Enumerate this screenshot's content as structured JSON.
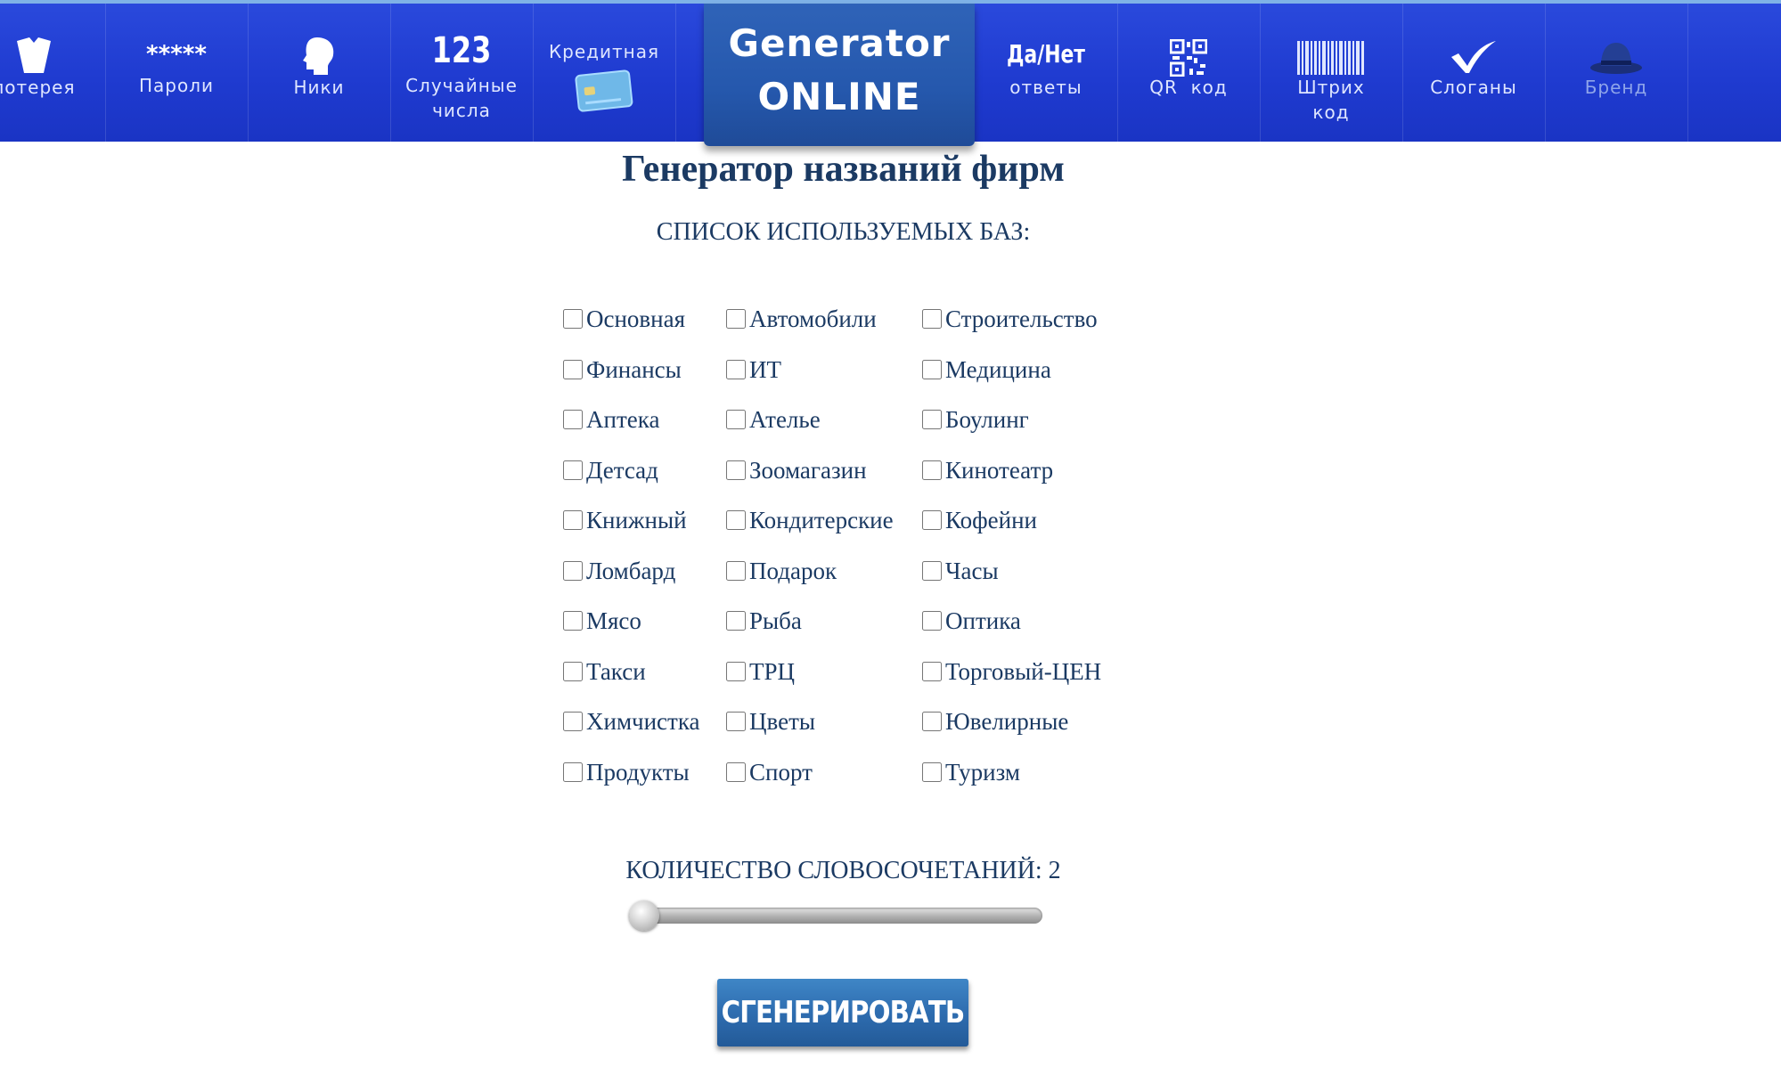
{
  "nav": {
    "items": [
      {
        "label": "лотерея"
      },
      {
        "label": "Пароли",
        "symbol": "*****"
      },
      {
        "label": "Ники"
      },
      {
        "label_line1": "Случайные",
        "label_line2": "числа",
        "symbol": "123"
      },
      {
        "label": "Кредитная"
      },
      {
        "label_line1": "Да/Нет",
        "label_line2": "ответы"
      },
      {
        "label": "QR  код"
      },
      {
        "label_line1": "Штрих",
        "label_line2": "код"
      },
      {
        "label": "Слоганы"
      },
      {
        "label": "Бренд"
      }
    ],
    "logo": {
      "line1": "Generator",
      "line2": "ONLINE"
    }
  },
  "main": {
    "title": "Генератор названий фирм",
    "bases_label": "СПИСОК ИСПОЛЬЗУЕМЫХ БАЗ:",
    "bases": [
      "Основная",
      "Автомобили",
      "Строительство",
      "Финансы",
      "ИТ",
      "Медицина",
      "Аптека",
      "Ателье",
      "Боулинг",
      "Детсад",
      "Зоомагазин",
      "Кинотеатр",
      "Книжный",
      "Кондитерские",
      "Кофейни",
      "Ломбард",
      "Подарок",
      "Часы",
      "Мясо",
      "Рыба",
      "Оптика",
      "Такси",
      "ТРЦ",
      "Торговый-ЦЕН",
      "Химчистка",
      "Цветы",
      "Ювелирные",
      "Продукты",
      "Спорт",
      "Туризм"
    ],
    "count_label": "КОЛИЧЕСТВО СЛОВОСОЧЕТАНИЙ: 2",
    "count_value": 2,
    "generate_label": "СГЕНЕРИРОВАТЬ"
  },
  "colors": {
    "nav_bg": "#1f3bd0",
    "logo_bg": "#2558ad",
    "text": "#1b3a63",
    "button": "#2e6db0"
  }
}
